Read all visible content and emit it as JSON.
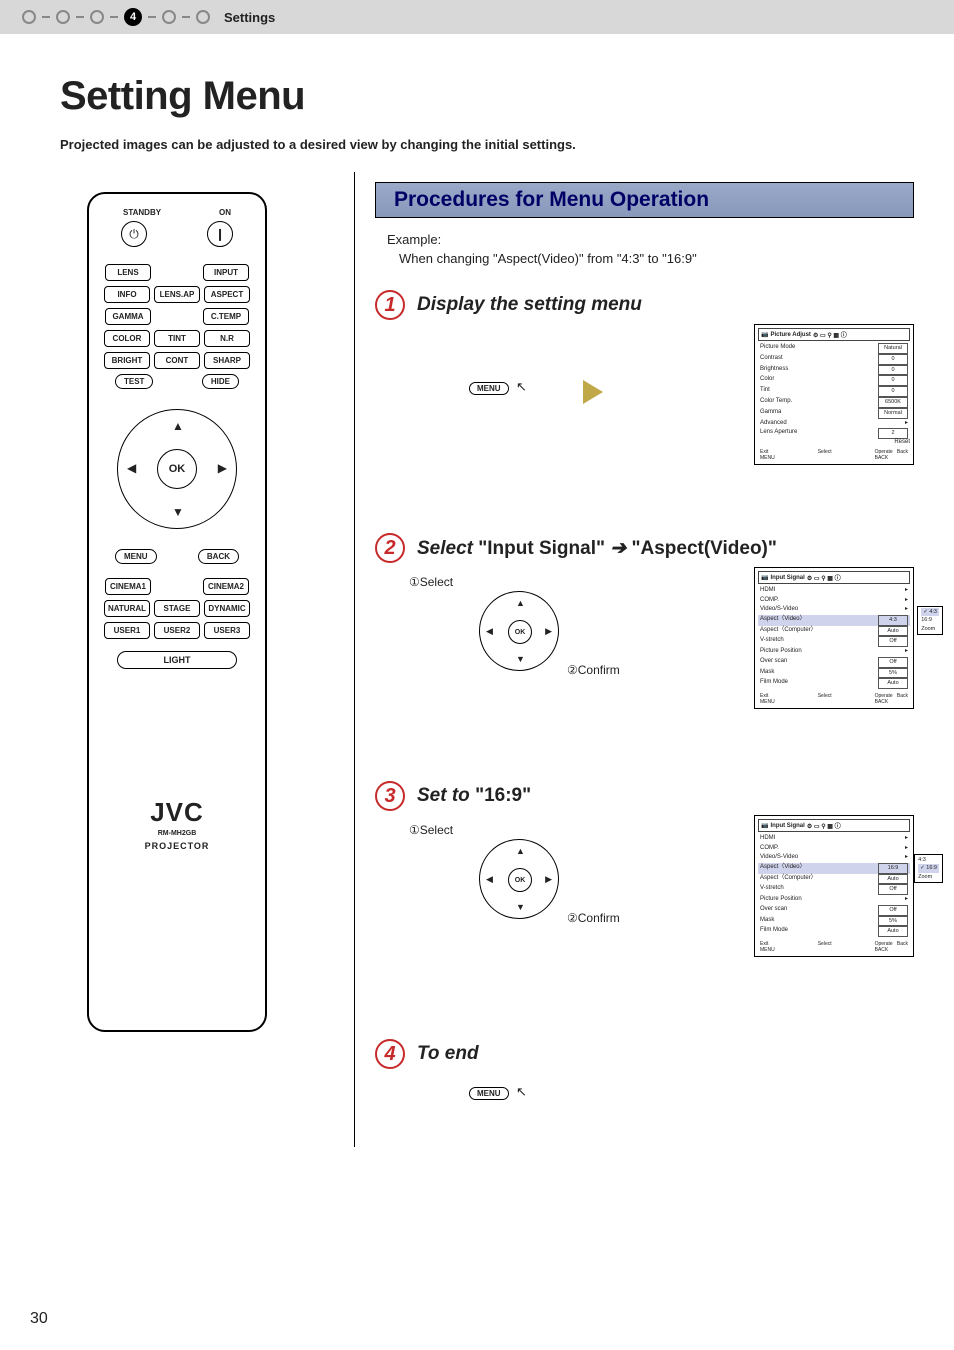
{
  "topbar": {
    "step_num": "4",
    "label": "Settings"
  },
  "page": {
    "title": "Setting Menu",
    "intro": "Projected images can be adjusted to a desired view by changing the initial settings.",
    "number": "30"
  },
  "remote": {
    "standby_lbl": "STANDBY",
    "on_lbl": "ON",
    "lens": "LENS",
    "input": "INPUT",
    "info": "INFO",
    "lensap": "LENS.AP",
    "aspect": "ASPECT",
    "gamma": "GAMMA",
    "ctemp": "C.TEMP",
    "color": "COLOR",
    "tint": "TINT",
    "nr": "N.R",
    "bright": "BRIGHT",
    "cont": "CONT",
    "sharp": "SHARP",
    "test": "TEST",
    "hide": "HIDE",
    "ok": "OK",
    "menu": "MENU",
    "back": "BACK",
    "cinema1": "CINEMA1",
    "cinema2": "CINEMA2",
    "natural": "NATURAL",
    "stage": "STAGE",
    "dynamic": "DYNAMIC",
    "user1": "USER1",
    "user2": "USER2",
    "user3": "USER3",
    "light": "LIGHT",
    "brand": "JVC",
    "model": "RM-MH2GB",
    "projector": "PROJECTOR"
  },
  "procedures": {
    "heading": "Procedures for Menu Operation",
    "example_label": "Example:",
    "example_text": "When changing \"Aspect(Video)\" from \"4:3\" to \"16:9\"",
    "menu_btn": "MENU",
    "select_label": "①Select",
    "confirm_label": "②Confirm",
    "ok": "OK",
    "steps": [
      {
        "num": "1",
        "title": "Display the setting menu"
      },
      {
        "num": "2",
        "title_pre": "Select ",
        "title_q1": "\"Input Signal\"",
        "title_arrow": " ➔ ",
        "title_q2": "\"Aspect(Video)\""
      },
      {
        "num": "3",
        "title_pre": "Set to ",
        "title_q1": "\"16:9\""
      },
      {
        "num": "4",
        "title": "To end"
      }
    ]
  },
  "osd1": {
    "heading": "Picture Adjust",
    "picture_mode": "Picture Mode",
    "picture_mode_val": "Natural",
    "rows": [
      {
        "k": "Contrast",
        "v": "0"
      },
      {
        "k": "Brightness",
        "v": "0"
      },
      {
        "k": "Color",
        "v": "0"
      },
      {
        "k": "Tint",
        "v": "0"
      },
      {
        "k": "Color Temp.",
        "v": "6500K"
      },
      {
        "k": "Gamma",
        "v": "Normal"
      },
      {
        "k": "Advanced",
        "v": ""
      },
      {
        "k": "Lens Aperture",
        "v": "2"
      }
    ],
    "reset": "Reset",
    "exit": "Exit",
    "menu": "MENU",
    "select": "Select",
    "operate": "Operate",
    "back": "Back",
    "back_btn": "BACK"
  },
  "osd2": {
    "heading": "Input Signal",
    "rows": [
      {
        "k": "HDMI",
        "v": ""
      },
      {
        "k": "COMP.",
        "v": ""
      },
      {
        "k": "Video/S-Video",
        "v": ""
      },
      {
        "k": "Aspect（Video）",
        "v": "4:3",
        "hl": true
      },
      {
        "k": "Aspect（Computer）",
        "v": "Auto"
      },
      {
        "k": "V-stretch",
        "v": "Off"
      },
      {
        "k": "Picture Position",
        "v": ""
      },
      {
        "k": "Over scan",
        "v": "Off"
      },
      {
        "k": "Mask",
        "v": "5%"
      },
      {
        "k": "Film Mode",
        "v": "Auto"
      }
    ],
    "popup": [
      "4:3",
      "16:9",
      "Zoom"
    ],
    "exit": "Exit",
    "menu": "MENU",
    "select": "Select",
    "operate": "Operate",
    "back": "Back",
    "back_btn": "BACK"
  },
  "osd3": {
    "heading": "Input Signal",
    "rows": [
      {
        "k": "HDMI",
        "v": ""
      },
      {
        "k": "COMP.",
        "v": ""
      },
      {
        "k": "Video/S-Video",
        "v": ""
      },
      {
        "k": "Aspect（Video）",
        "v": "16:9",
        "hl": true
      },
      {
        "k": "Aspect（Computer）",
        "v": "Auto"
      },
      {
        "k": "V-stretch",
        "v": "Off"
      },
      {
        "k": "Picture Position",
        "v": ""
      },
      {
        "k": "Over scan",
        "v": "Off"
      },
      {
        "k": "Mask",
        "v": "5%"
      },
      {
        "k": "Film Mode",
        "v": "Auto"
      }
    ],
    "popup": [
      "4:3",
      "16:9",
      "Zoom"
    ],
    "exit": "Exit",
    "menu": "MENU",
    "select": "Select",
    "operate": "Operate",
    "back": "Back",
    "back_btn": "BACK"
  }
}
